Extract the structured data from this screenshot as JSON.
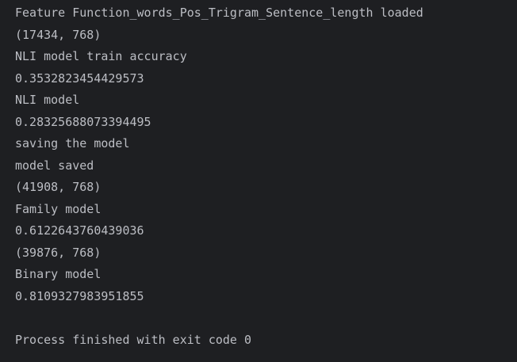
{
  "console": {
    "lines": [
      "Feature Function_words_Pos_Trigram_Sentence_length loaded",
      "(17434, 768)",
      "NLI model train accuracy",
      "0.3532823454429573",
      "NLI model",
      "0.28325688073394495",
      "saving the model",
      "model saved",
      "(41908, 768)",
      "Family model",
      "0.6122643760439036",
      "(39876, 768)",
      "Binary model",
      "0.8109327983951855"
    ],
    "exit_message": "Process finished with exit code 0"
  },
  "colors": {
    "background": "#1e1f22",
    "text": "#bcbec4"
  }
}
